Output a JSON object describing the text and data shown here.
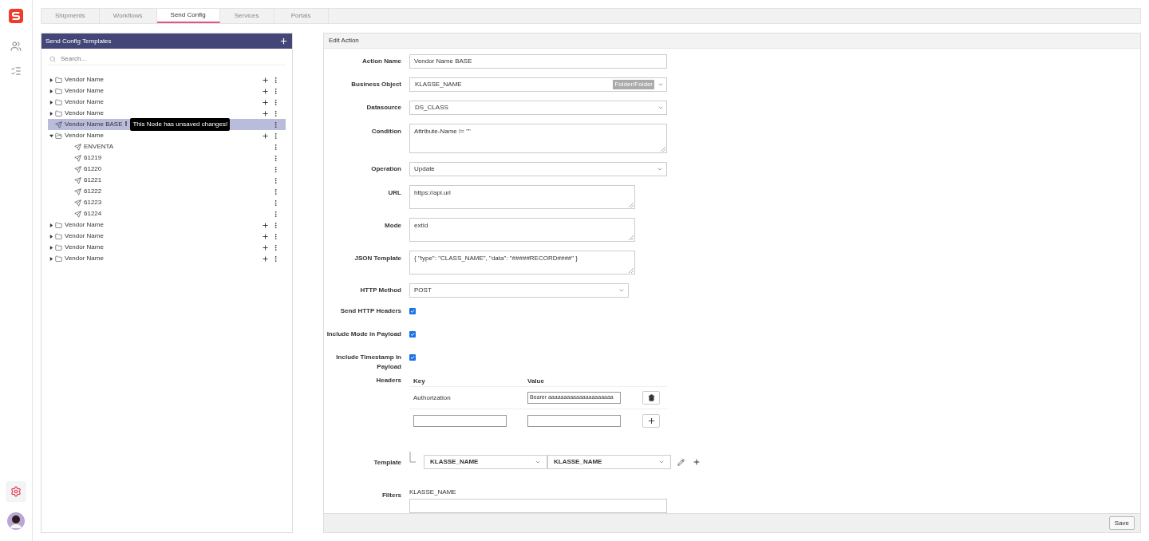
{
  "tabs": [
    {
      "label": "Shipments",
      "selected": false
    },
    {
      "label": "Workflows",
      "selected": false
    },
    {
      "label": "Send Config",
      "selected": true
    },
    {
      "label": "Services",
      "selected": false
    },
    {
      "label": "Portals",
      "selected": false
    }
  ],
  "templates_panel": {
    "title": "Send Config Templates",
    "search": {
      "placeholder": "Search..."
    },
    "tree": [
      {
        "kind": "folder",
        "label": "Vendor Name",
        "expanded": false,
        "selected": false
      },
      {
        "kind": "folder",
        "label": "Vendor Name",
        "expanded": false,
        "selected": false
      },
      {
        "kind": "folder",
        "label": "Vendor Name",
        "expanded": false,
        "selected": false
      },
      {
        "kind": "folder",
        "label": "Vendor Name",
        "expanded": false,
        "selected": false
      },
      {
        "kind": "action",
        "label": "Vendor Name BASE",
        "selected": true,
        "unsaved_mark": "!",
        "tooltip": "This Node has unsaved changes!"
      },
      {
        "kind": "folder",
        "label": "Vendor Name",
        "expanded": true,
        "selected": false,
        "children": [
          {
            "kind": "action",
            "label": "ENVENTA",
            "selected": false
          },
          {
            "kind": "action",
            "label": "61219",
            "selected": false
          },
          {
            "kind": "action",
            "label": "61220",
            "selected": false
          },
          {
            "kind": "action",
            "label": "61221",
            "selected": false
          },
          {
            "kind": "action",
            "label": "61222",
            "selected": false
          },
          {
            "kind": "action",
            "label": "61223",
            "selected": false
          },
          {
            "kind": "action",
            "label": "61224",
            "selected": false
          }
        ]
      },
      {
        "kind": "folder",
        "label": "Vendor Name",
        "expanded": false,
        "selected": false
      },
      {
        "kind": "folder",
        "label": "Vendor Name",
        "expanded": false,
        "selected": false
      },
      {
        "kind": "folder",
        "label": "Vendor Name",
        "expanded": false,
        "selected": false
      },
      {
        "kind": "folder",
        "label": "Vendor Name",
        "expanded": false,
        "selected": false
      }
    ]
  },
  "edit_panel": {
    "title": "Edit Action",
    "fields": [
      {
        "kind": "text",
        "label": "Action Name",
        "value": "Vendor Name BASE"
      },
      {
        "kind": "combo",
        "label": "Business Object",
        "value": "KLASSE_NAME",
        "tag": "Folder/Folder"
      },
      {
        "kind": "combo",
        "label": "Datasource",
        "value": "DS_CLASS"
      },
      {
        "kind": "textarea",
        "label": "Condition",
        "value": "Attribute-Name != \"\""
      },
      {
        "kind": "select",
        "label": "Operation",
        "value": "Update"
      },
      {
        "kind": "textarea-short",
        "label": "URL",
        "value": "https://api.url"
      },
      {
        "kind": "textarea-short",
        "label": "Mode",
        "value": "extId"
      },
      {
        "kind": "textarea-short",
        "label": "JSON Template",
        "value": "{ \"type\": \"CLASS_NAME\", \"data\": \"#####RECORD####\" }"
      },
      {
        "kind": "select-short",
        "label": "HTTP Method",
        "value": "POST"
      },
      {
        "kind": "checkbox",
        "label": "Send HTTP Headers",
        "checked": true
      },
      {
        "kind": "checkbox",
        "label": "Include Mode in Payload",
        "checked": true
      },
      {
        "kind": "checkbox",
        "label": "Include Timestamp in Payload",
        "checked": true
      },
      {
        "kind": "headers",
        "label": "Headers",
        "columns": [
          "Key",
          "Value"
        ],
        "rows": [
          {
            "key": "Authorization",
            "value": "Bearer aaaaaaaaaaaaaaaaaaaaa"
          }
        ]
      },
      {
        "kind": "template",
        "label": "Template",
        "values": [
          "KLASSE_NAME",
          "KLASSE_NAME"
        ]
      },
      {
        "kind": "filters",
        "label": "Filters",
        "value": "KLASSE_NAME"
      }
    ],
    "save": "Save"
  }
}
